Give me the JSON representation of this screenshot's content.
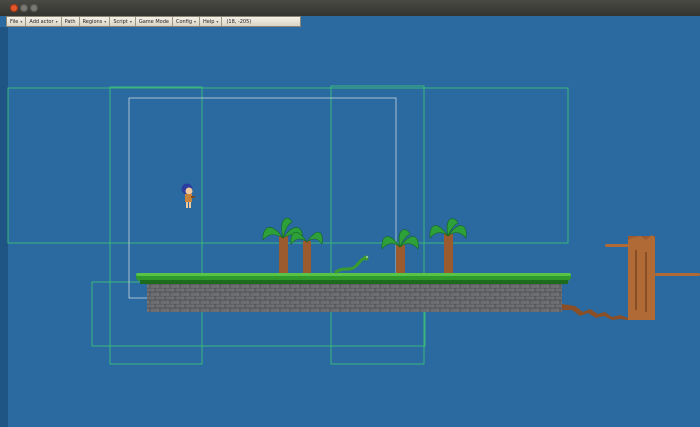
{
  "window": {
    "controls": [
      "close-button",
      "minimize-button",
      "maximize-button"
    ]
  },
  "menubar": {
    "items": [
      {
        "label": "File",
        "arrow": true
      },
      {
        "label": "Add actor",
        "arrow": true
      },
      {
        "label": "Path",
        "arrow": false
      },
      {
        "label": "Regions",
        "arrow": true
      },
      {
        "label": "Script",
        "arrow": true
      },
      {
        "label": "Game Mode",
        "arrow": false
      },
      {
        "label": "Config",
        "arrow": true
      },
      {
        "label": "Help",
        "arrow": true
      }
    ],
    "coordinates": "(18, -205)"
  },
  "colors": {
    "background": "#2b6aa0",
    "region_outline": "#3bbf7a",
    "view_outline": "#c9d6e3",
    "grass": "#2f9a2b",
    "stone": "#6b6d70",
    "tree_trunk": "#9c5b2f",
    "leaf": "#2ea03a"
  }
}
